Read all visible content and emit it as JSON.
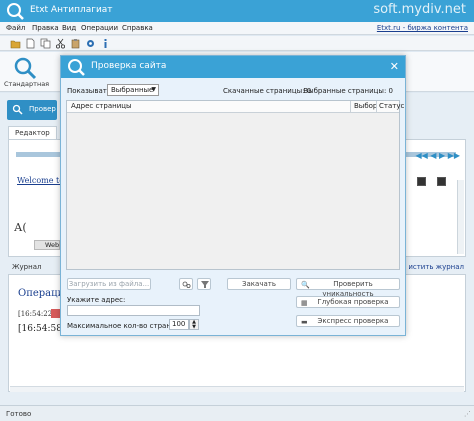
{
  "app": {
    "title": "Etxt Антиплагиат",
    "watermark": "soft.mydiv.net",
    "status": "Готово"
  },
  "menu": {
    "items": [
      "Файл",
      "Правка",
      "Вид",
      "Операции",
      "Справка"
    ],
    "link": "Etxt.ru - биржа контента"
  },
  "toolbar": {
    "icons": [
      "folder-open-icon",
      "new-document-icon",
      "copy-icon",
      "scissors-icon",
      "paste-icon",
      "settings-icon",
      "info-icon"
    ]
  },
  "ribbon": {
    "standard_label": "Стандартная"
  },
  "main": {
    "check_button": "Провер",
    "editor_tab": "Редактор",
    "welcome_link": "Welcome to M",
    "aa_text": "А(",
    "web_chip": "Web",
    "journal_tab": "Журнал",
    "journal_right": "истить журнал",
    "operation_title": "Операция",
    "log_line1": "[16:54:22]",
    "log_line2": "[16:54:58]"
  },
  "dialog": {
    "title": "Проверка сайта",
    "show_label": "Показывать:",
    "show_value": "Выбранные",
    "downloaded": "Скачанные страницы: 0",
    "selected": "Выбранные страницы: 0",
    "columns": [
      "Адрес страницы",
      "Выбор",
      "Статус"
    ],
    "load_from_file": "Загрузить из файла...",
    "download": "Закачать",
    "check_uniqueness": "Проверить уникальность",
    "deep_check": "Глубокая проверка",
    "express_check": "Экспресс проверка",
    "address_label": "Укажите адрес:",
    "address_value": "",
    "max_pages_label": "Максимальное кол-во страниц:",
    "max_pages_value": "100"
  },
  "colors": {
    "accent": "#3aa2d6",
    "link": "#1a3f8f"
  }
}
